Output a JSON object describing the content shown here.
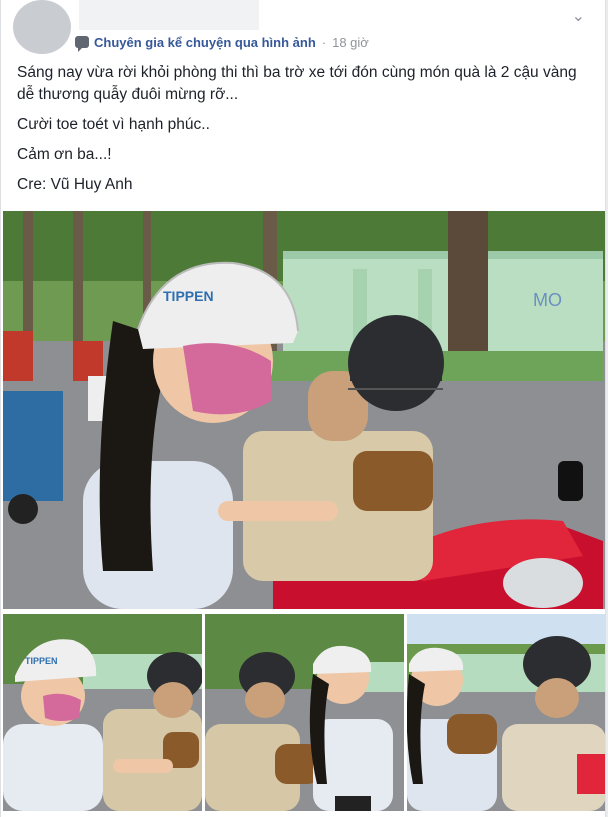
{
  "post": {
    "group_name": "Chuyên gia kể chuyện qua hình ảnh",
    "dot": "·",
    "time": "18 giờ",
    "paragraphs": [
      "Sáng nay vừa rời khỏi phòng thi thì ba trờ xe tới đón cùng món quà là 2 cậu vàng dễ thương quẫy đuôi mừng rỡ...",
      "Cười toe toét vì hạnh phúc..",
      "Cảm ơn ba...!",
      "Cre: Vũ Huy Anh"
    ]
  },
  "icons": {
    "options": "chevron-down-icon",
    "group": "message-bubble-icon"
  },
  "photos": {
    "helmet_text": "TIPPEN",
    "wall_graffiti": "MO"
  }
}
